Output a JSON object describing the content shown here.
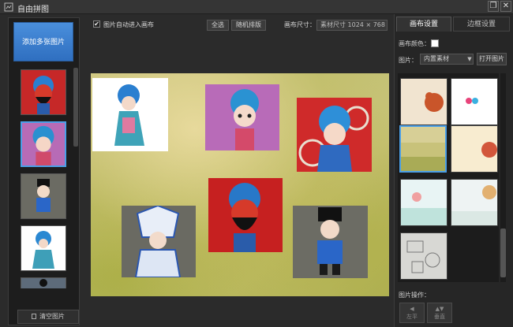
{
  "window": {
    "title": "自由拼图",
    "restore_glyph": "❐",
    "close_glyph": "✕"
  },
  "left": {
    "add_label": "添加多张图片",
    "clear_label": "清空图片",
    "thumbnails": [
      "opera-red-face",
      "opera-girl-pink",
      "opera-official-gray",
      "opera-girl-blue",
      "opera-partial"
    ]
  },
  "toolbar": {
    "auto_canvas_checked": "✔",
    "auto_canvas_label": "图片自动进入画布",
    "select_all": "全选",
    "random_layout": "随机排版",
    "size_label": "画布尺寸：",
    "size_value": "素材尺寸  1024  ×  768"
  },
  "right": {
    "tab_canvas": "画布设置",
    "tab_border": "边框设置",
    "canvas_color_label": "画布颜色：",
    "canvas_color": "#ffffff",
    "image_label": "图片：",
    "image_select": "内置素材",
    "open_image": "打开图片",
    "photo_ops_label": "图片操作：",
    "op_left": "左平",
    "op_right": "垂直"
  },
  "colors": {
    "accent": "#4a9fe8",
    "add_button": "#3b7fd0"
  }
}
